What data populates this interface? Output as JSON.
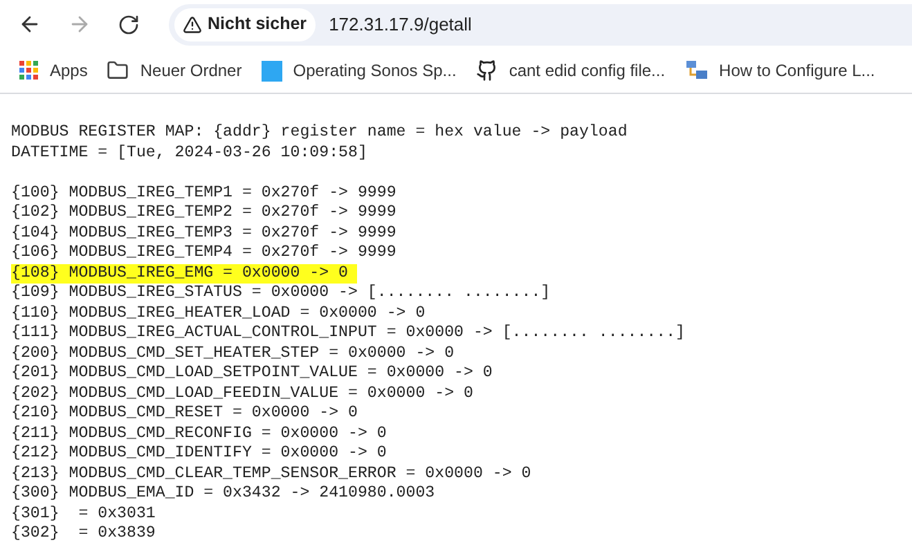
{
  "toolbar": {
    "back": {
      "disabled": false
    },
    "forward": {
      "disabled": true
    },
    "security": "Nicht sicher",
    "url": "172.31.17.9/getall"
  },
  "bookmarks": [
    {
      "kind": "apps",
      "label": "Apps"
    },
    {
      "kind": "folder",
      "label": "Neuer Ordner"
    },
    {
      "kind": "page",
      "label": "Operating Sonos Sp..."
    },
    {
      "kind": "github",
      "label": "cant edid config file..."
    },
    {
      "kind": "network",
      "label": "How to Configure L..."
    }
  ],
  "page": {
    "header": [
      "MODBUS REGISTER MAP: {addr} register name = hex value -> payload",
      "DATETIME = [Tue, 2024-03-26 10:09:58]"
    ],
    "rows": [
      {
        "text": "{100} MODBUS_IREG_TEMP1 = 0x270f -> 9999",
        "highlighted": false
      },
      {
        "text": "{102} MODBUS_IREG_TEMP2 = 0x270f -> 9999",
        "highlighted": false
      },
      {
        "text": "{104} MODBUS_IREG_TEMP3 = 0x270f -> 9999",
        "highlighted": false
      },
      {
        "text": "{106} MODBUS_IREG_TEMP4 = 0x270f -> 9999",
        "highlighted": false
      },
      {
        "text": "{108} MODBUS_IREG_EMG = 0x0000 -> 0",
        "highlighted": true
      },
      {
        "text": "{109} MODBUS_IREG_STATUS = 0x0000 -> [........ ........]",
        "highlighted": false
      },
      {
        "text": "{110} MODBUS_IREG_HEATER_LOAD = 0x0000 -> 0",
        "highlighted": false
      },
      {
        "text": "{111} MODBUS_IREG_ACTUAL_CONTROL_INPUT = 0x0000 -> [........ ........]",
        "highlighted": false
      },
      {
        "text": "{200} MODBUS_CMD_SET_HEATER_STEP = 0x0000 -> 0",
        "highlighted": false
      },
      {
        "text": "{201} MODBUS_CMD_LOAD_SETPOINT_VALUE = 0x0000 -> 0",
        "highlighted": false
      },
      {
        "text": "{202} MODBUS_CMD_LOAD_FEEDIN_VALUE = 0x0000 -> 0",
        "highlighted": false
      },
      {
        "text": "{210} MODBUS_CMD_RESET = 0x0000 -> 0",
        "highlighted": false
      },
      {
        "text": "{211} MODBUS_CMD_RECONFIG = 0x0000 -> 0",
        "highlighted": false
      },
      {
        "text": "{212} MODBUS_CMD_IDENTIFY = 0x0000 -> 0",
        "highlighted": false
      },
      {
        "text": "{213} MODBUS_CMD_CLEAR_TEMP_SENSOR_ERROR = 0x0000 -> 0",
        "highlighted": false
      },
      {
        "text": "{300} MODBUS_EMA_ID = 0x3432 -> 2410980.0003",
        "highlighted": false
      },
      {
        "text": "{301}  = 0x3031",
        "highlighted": false
      },
      {
        "text": "{302}  = 0x3839",
        "highlighted": false
      }
    ]
  }
}
